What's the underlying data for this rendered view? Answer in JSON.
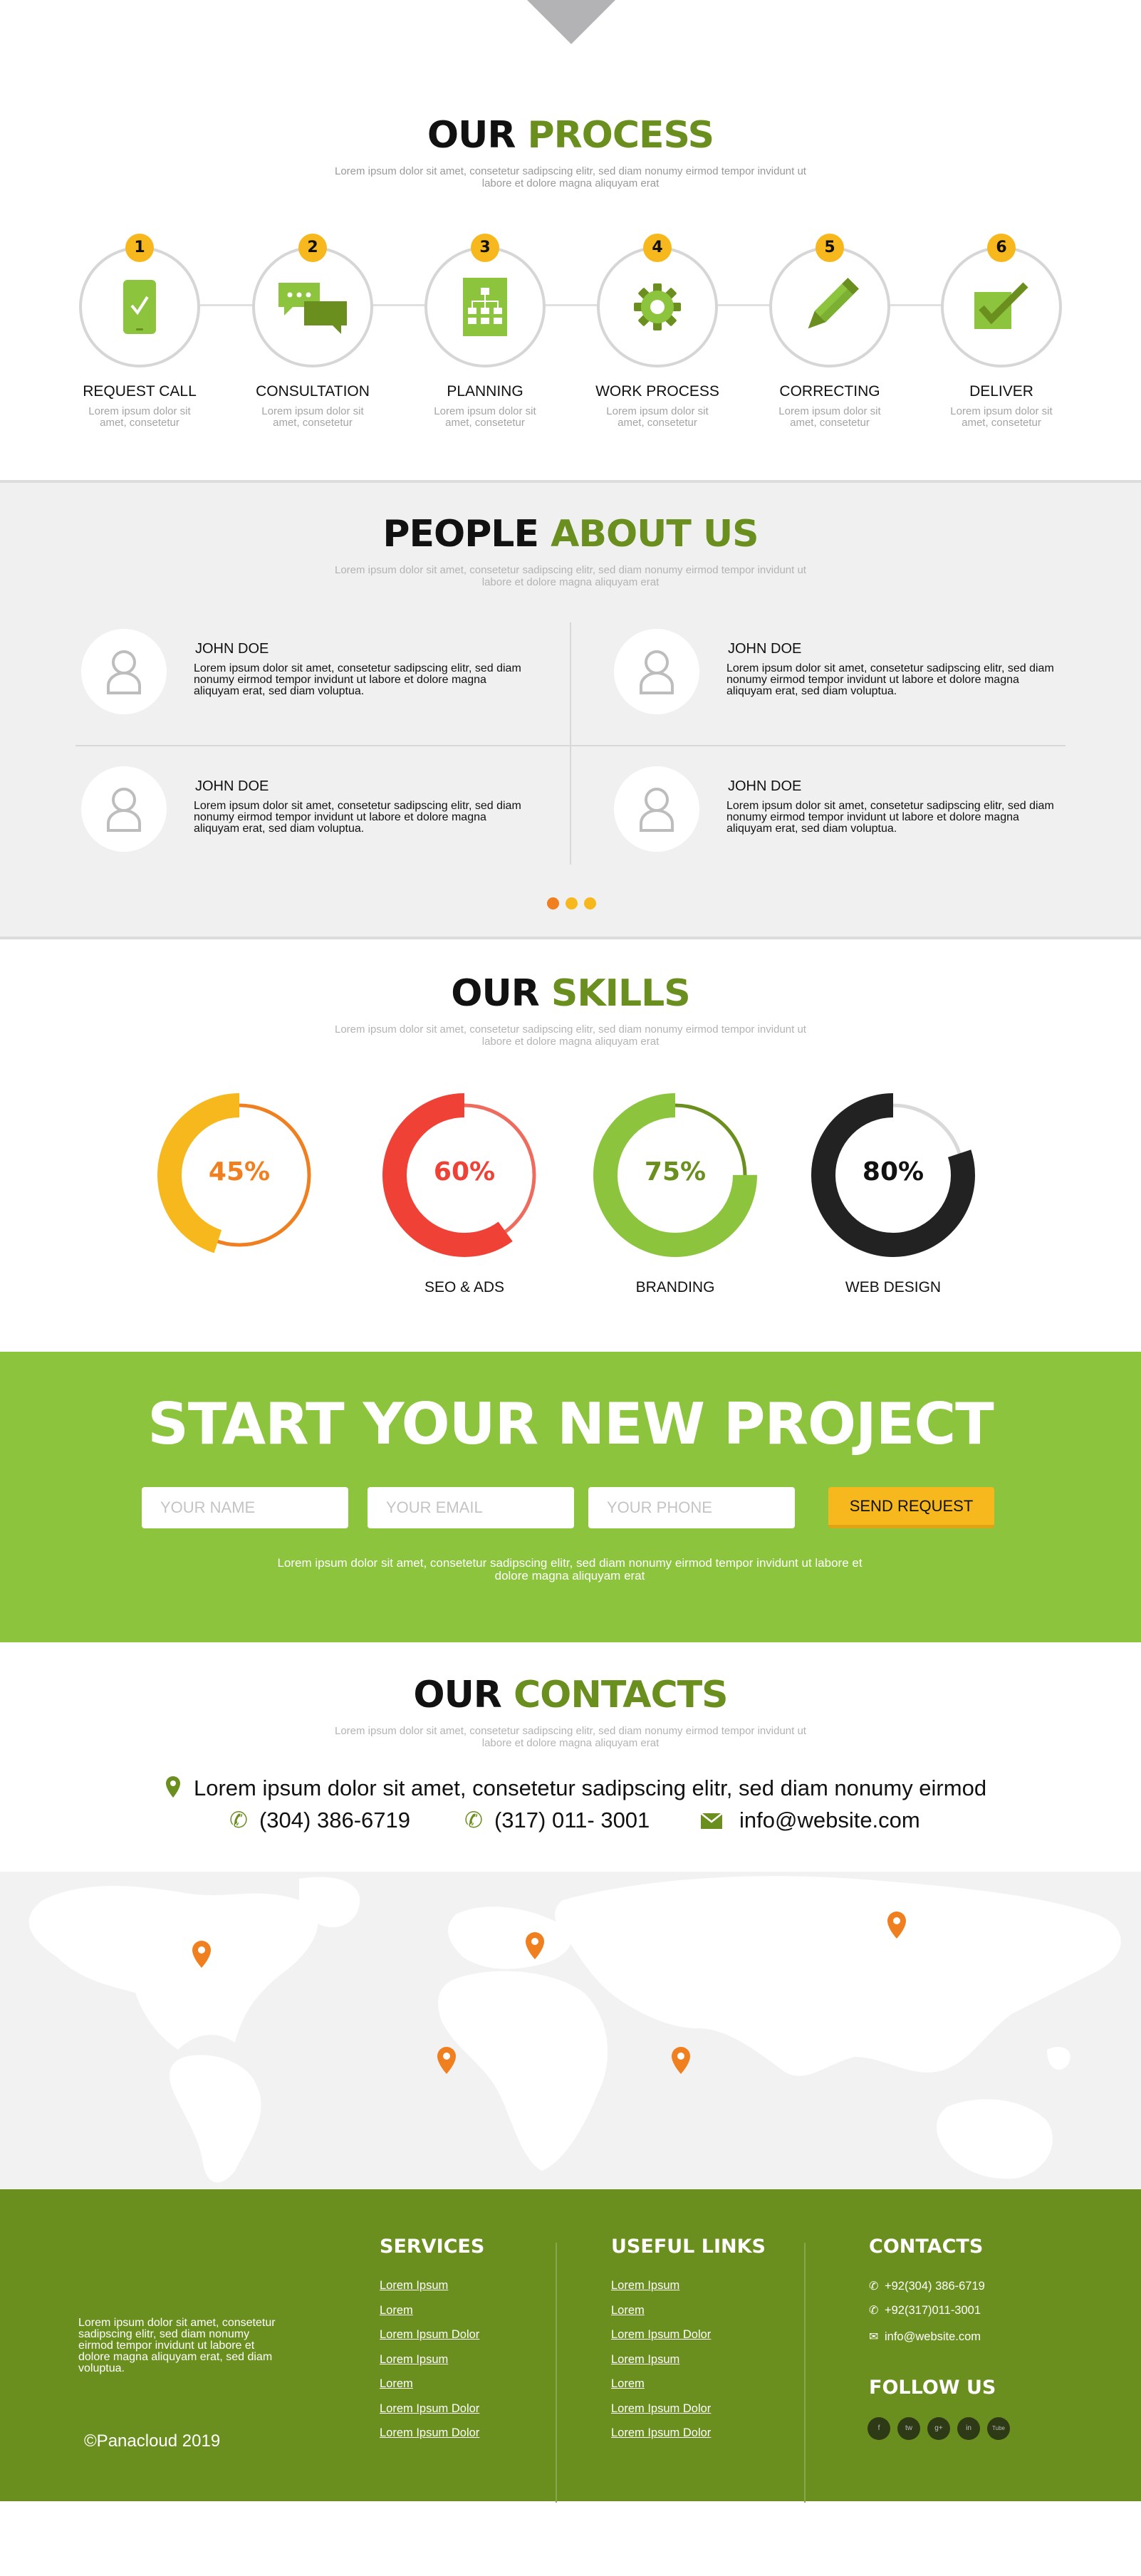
{
  "process": {
    "title_a": "OUR",
    "title_b": "PROCESS",
    "subtitle": "Lorem ipsum dolor sit amet, consetetur sadipscing elitr, sed diam nonumy eirmod tempor invidunt ut labore et dolore magna aliquyam erat",
    "steps": [
      {
        "num": "1",
        "label": "REQUEST CALL",
        "desc": "Lorem ipsum dolor sit amet, consetetur",
        "icon": "smartphone-check-icon"
      },
      {
        "num": "2",
        "label": "CONSULTATION",
        "desc": "Lorem ipsum dolor sit amet, consetetur",
        "icon": "chat-bubbles-icon"
      },
      {
        "num": "3",
        "label": "PLANNING",
        "desc": "Lorem ipsum dolor sit amet, consetetur",
        "icon": "sitemap-document-icon"
      },
      {
        "num": "4",
        "label": "WORK PROCESS",
        "desc": "Lorem ipsum dolor sit amet, consetetur",
        "icon": "gear-icon"
      },
      {
        "num": "5",
        "label": "CORRECTING",
        "desc": "Lorem ipsum dolor sit amet, consetetur",
        "icon": "pencil-icon"
      },
      {
        "num": "6",
        "label": "DELIVER",
        "desc": "Lorem ipsum dolor sit amet, consetetur",
        "icon": "checkbox-icon"
      }
    ]
  },
  "people": {
    "title_a": "PEOPLE",
    "title_b": "ABOUT US",
    "subtitle": "Lorem ipsum dolor sit amet, consetetur sadipscing elitr, sed diam nonumy eirmod tempor invidunt ut labore et dolore magna aliquyam erat",
    "items": [
      {
        "name": "JOHN DOE",
        "text": "Lorem ipsum dolor sit amet, consetetur sadipscing elitr, sed diam nonumy eirmod tempor invidunt ut labore et dolore magna aliquyam erat, sed diam voluptua."
      },
      {
        "name": "JOHN DOE",
        "text": "Lorem ipsum dolor sit amet, consetetur sadipscing elitr, sed diam nonumy eirmod tempor invidunt ut labore et dolore magna aliquyam erat, sed diam voluptua."
      },
      {
        "name": "JOHN DOE",
        "text": "Lorem ipsum dolor sit amet, consetetur sadipscing elitr, sed diam nonumy eirmod tempor invidunt ut labore et dolore magna aliquyam erat, sed diam voluptua."
      },
      {
        "name": "JOHN DOE",
        "text": "Lorem ipsum dolor sit amet, consetetur sadipscing elitr, sed diam nonumy eirmod tempor invidunt ut labore et dolore magna aliquyam erat, sed diam voluptua."
      }
    ],
    "carousel_active_index": 0
  },
  "skills": {
    "title_a": "OUR",
    "title_b": "SKILLS",
    "subtitle": "Lorem ipsum dolor sit amet, consetetur sadipscing elitr, sed diam nonumy eirmod tempor invidunt ut labore et dolore magna aliquyam erat",
    "items": [
      {
        "pct": "45%",
        "value": 45,
        "label": "",
        "color": "#f6b81c",
        "track": "#f07f1f",
        "text_color": "#f07f1f"
      },
      {
        "pct": "60%",
        "value": 60,
        "label": "SEO & ADS",
        "color": "#ef4136",
        "track": "#ef6b5e",
        "text_color": "#ef4136"
      },
      {
        "pct": "75%",
        "value": 75,
        "label": "BRANDING",
        "color": "#8cc43e",
        "track": "#6a8f1e",
        "text_color": "#6a8f1e"
      },
      {
        "pct": "80%",
        "value": 80,
        "label": "WEB DESIGN",
        "color": "#222222",
        "track": "#d9d9d9",
        "text_color": "#111111"
      }
    ]
  },
  "project": {
    "title": "START YOUR NEW PROJECT",
    "name_placeholder": "YOUR NAME",
    "email_placeholder": "YOUR EMAIL",
    "phone_placeholder": "YOUR PHONE",
    "button": "SEND REQUEST",
    "text": "Lorem ipsum dolor sit amet, consetetur sadipscing elitr, sed diam nonumy eirmod tempor invidunt ut labore et dolore magna aliquyam erat"
  },
  "contacts": {
    "title_a": "OUR",
    "title_b": "CONTACTS",
    "subtitle": "Lorem ipsum dolor sit amet, consetetur sadipscing elitr, sed diam nonumy eirmod tempor invidunt ut labore et dolore magna aliquyam erat",
    "address": "Lorem ipsum dolor sit amet, consetetur sadipscing elitr, sed diam nonumy eirmod",
    "phone1": "(304) 386-6719",
    "phone2": "(317) 011- 3001",
    "email": "info@website.com"
  },
  "footer": {
    "about": "Lorem ipsum dolor sit amet, consetetur sadipscing elitr, sed diam nonumy eirmod tempor invidunt ut labore et dolore magna aliquyam erat, sed diam voluptua.",
    "copyright": "©Panacloud 2019",
    "services_title": "SERVICES",
    "services": [
      "Lorem Ipsum",
      "Lorem",
      "Lorem Ipsum Dolor",
      "Lorem Ipsum",
      "Lorem",
      "Lorem Ipsum Dolor",
      "Lorem Ipsum Dolor"
    ],
    "useful_title": "USEFUL LINKS",
    "useful": [
      "Lorem Ipsum",
      "Lorem",
      "Lorem Ipsum Dolor",
      "Lorem Ipsum",
      "Lorem",
      "Lorem Ipsum Dolor",
      "Lorem Ipsum Dolor"
    ],
    "contacts_title": "CONTACTS",
    "phone1": "+92(304) 386-6719",
    "phone2": "+92(317)011-3001",
    "email": "info@website.com",
    "follow_title": "FOLLOW US",
    "social": [
      "f",
      "tw",
      "g+",
      "in",
      "Tube"
    ]
  },
  "colors": {
    "accent": "#6a8f1e",
    "light_green": "#8cc43e",
    "yellow": "#f6b81c",
    "orange": "#f07f1f"
  }
}
